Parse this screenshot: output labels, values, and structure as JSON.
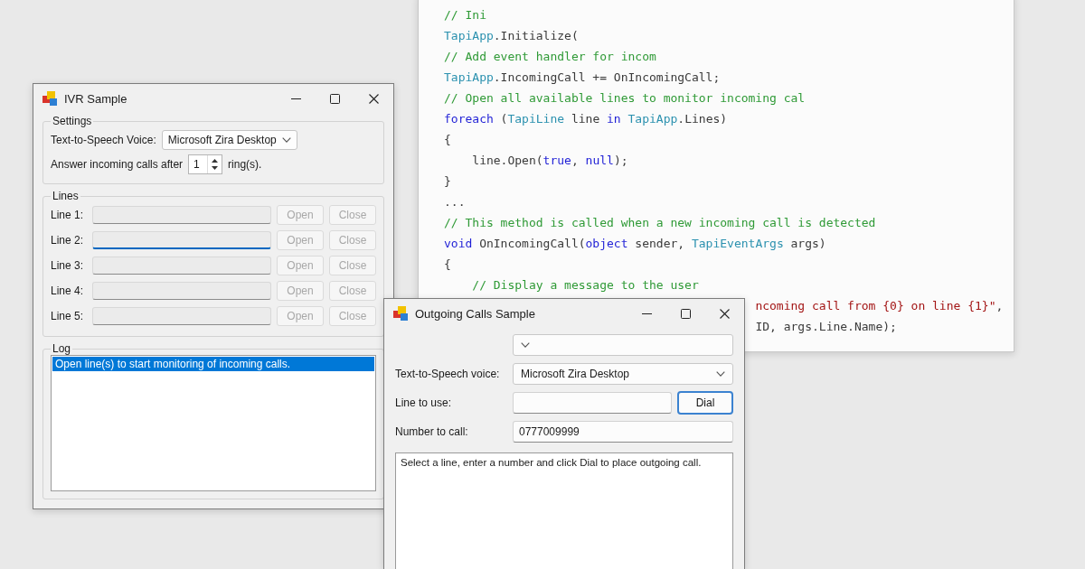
{
  "code_editor": {
    "lines": [
      {
        "tokens": [
          {
            "kind": "comment",
            "text": "// Ini"
          }
        ]
      },
      {
        "tokens": [
          {
            "kind": "type",
            "text": "TapiApp"
          },
          {
            "kind": "plain",
            "text": ".Initialize("
          }
        ]
      },
      {
        "tokens": [
          {
            "kind": "comment",
            "text": "// Add event handler for incom"
          }
        ]
      },
      {
        "tokens": [
          {
            "kind": "type",
            "text": "TapiApp"
          },
          {
            "kind": "plain",
            "text": ".IncomingCall += OnIncomingCall;"
          }
        ]
      },
      {
        "tokens": [
          {
            "kind": "comment",
            "text": "// Open all available lines to monitor incoming cal"
          }
        ]
      },
      {
        "tokens": [
          {
            "kind": "keyword",
            "text": "foreach"
          },
          {
            "kind": "plain",
            "text": " ("
          },
          {
            "kind": "type",
            "text": "TapiLine"
          },
          {
            "kind": "plain",
            "text": " line "
          },
          {
            "kind": "keyword",
            "text": "in"
          },
          {
            "kind": "type",
            "text": " TapiApp"
          },
          {
            "kind": "plain",
            "text": ".Lines)"
          }
        ]
      },
      {
        "tokens": [
          {
            "kind": "plain",
            "text": "{"
          }
        ]
      },
      {
        "tokens": [
          {
            "kind": "plain",
            "text": "    line.Open("
          },
          {
            "kind": "keyword",
            "text": "true"
          },
          {
            "kind": "plain",
            "text": ", "
          },
          {
            "kind": "keyword",
            "text": "null"
          },
          {
            "kind": "plain",
            "text": ");"
          }
        ]
      },
      {
        "tokens": [
          {
            "kind": "plain",
            "text": "}"
          }
        ]
      },
      {
        "tokens": [
          {
            "kind": "plain",
            "text": "..."
          }
        ]
      },
      {
        "tokens": [
          {
            "kind": "comment",
            "text": "// This method is called when a new incoming call is detected"
          }
        ]
      },
      {
        "tokens": [
          {
            "kind": "keyword",
            "text": "void"
          },
          {
            "kind": "plain",
            "text": " OnIncomingCall("
          },
          {
            "kind": "keyword",
            "text": "object"
          },
          {
            "kind": "plain",
            "text": " sender, "
          },
          {
            "kind": "type",
            "text": "TapiEventArgs"
          },
          {
            "kind": "plain",
            "text": " args)"
          }
        ]
      },
      {
        "tokens": [
          {
            "kind": "plain",
            "text": "{"
          }
        ]
      },
      {
        "tokens": [
          {
            "kind": "comment",
            "text": "    // Display a message to the user"
          }
        ]
      },
      {
        "tokens": [
          {
            "kind": "string",
            "text": "                                            ncoming call from {0} on line {1}\""
          },
          {
            "kind": "plain",
            "text": ","
          }
        ]
      },
      {
        "tokens": [
          {
            "kind": "plain",
            "text": "                                            ID, args.Line.Name);"
          }
        ]
      }
    ]
  },
  "ivr_window": {
    "title": "IVR Sample",
    "settings": {
      "legend": "Settings",
      "voice_label": "Text-to-Speech Voice:",
      "voice_value": "Microsoft Zira Desktop",
      "answer_label": "Answer incoming calls after",
      "rings_value": "1",
      "rings_suffix": "ring(s)."
    },
    "lines": {
      "legend": "Lines",
      "rows": [
        {
          "label": "Line 1:",
          "focused": false,
          "buttons": [
            {
              "label": "Open",
              "disabled": true
            },
            {
              "label": "Close",
              "disabled": true
            }
          ]
        },
        {
          "label": "Line 2:",
          "focused": true,
          "buttons": [
            {
              "label": "Open",
              "disabled": true
            },
            {
              "label": "Close",
              "disabled": true
            }
          ]
        },
        {
          "label": "Line 3:",
          "focused": false,
          "buttons": [
            {
              "label": "Open",
              "disabled": true
            },
            {
              "label": "Close",
              "disabled": true
            }
          ]
        },
        {
          "label": "Line 4:",
          "focused": false,
          "buttons": [
            {
              "label": "Open",
              "disabled": true
            },
            {
              "label": "Close",
              "disabled": true
            }
          ]
        },
        {
          "label": "Line 5:",
          "focused": false,
          "buttons": [
            {
              "label": "Open",
              "disabled": true
            },
            {
              "label": "Close",
              "disabled": true
            }
          ]
        }
      ]
    },
    "log": {
      "legend": "Log",
      "items": [
        {
          "text": "Open line(s) to start monitoring of incoming calls.",
          "selected": true
        }
      ]
    }
  },
  "outgoing_window": {
    "title": "Outgoing Calls Sample",
    "fields": [
      {
        "kind": "combo"
      },
      {
        "kind": "combo",
        "label": "Text-to-Speech voice:",
        "value": "Microsoft Zira Desktop"
      },
      {
        "kind": "text",
        "label": "Line to use:",
        "button": {
          "label": "Dial",
          "default": true
        }
      },
      {
        "kind": "text",
        "label": "Number to call:",
        "value": "0777009999"
      }
    ],
    "log_text": "Select a line, enter a number and click Dial to place outgoing call."
  }
}
